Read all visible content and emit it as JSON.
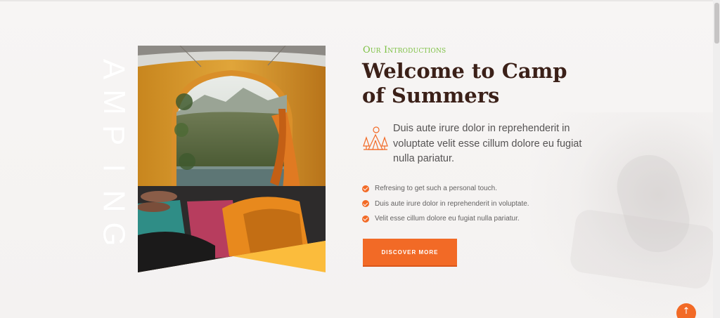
{
  "intro": {
    "vertical_letters": [
      "A",
      "M",
      "P",
      "I",
      "N",
      "G"
    ],
    "eyebrow": "Our Introductions",
    "title_line1": "Welcome to Camp",
    "title_line2": "of Summers",
    "lead_text": "Duis aute irure dolor in reprehenderit in voluptate velit esse cillum dolore eu fugiat nulla pariatur.",
    "checklist": [
      "Refresing to get such a personal touch.",
      "Duis aute irure dolor in reprehenderit in voluptate.",
      "Velit esse cillum dolore eu fugiat nulla pariatur."
    ],
    "button_label": "DISCOVER MORE",
    "feature_icon": "camp-tent-trees-icon",
    "photo": "tent-lake-view-photo"
  },
  "back_to_top": {
    "icon": "arrow-up-icon",
    "glyph": "↑"
  },
  "colors": {
    "accent": "#f26a26",
    "eyebrow_green": "#7cc043",
    "title_brown": "#3b2018",
    "photo_corner_yellow": "#fbbc3c"
  }
}
